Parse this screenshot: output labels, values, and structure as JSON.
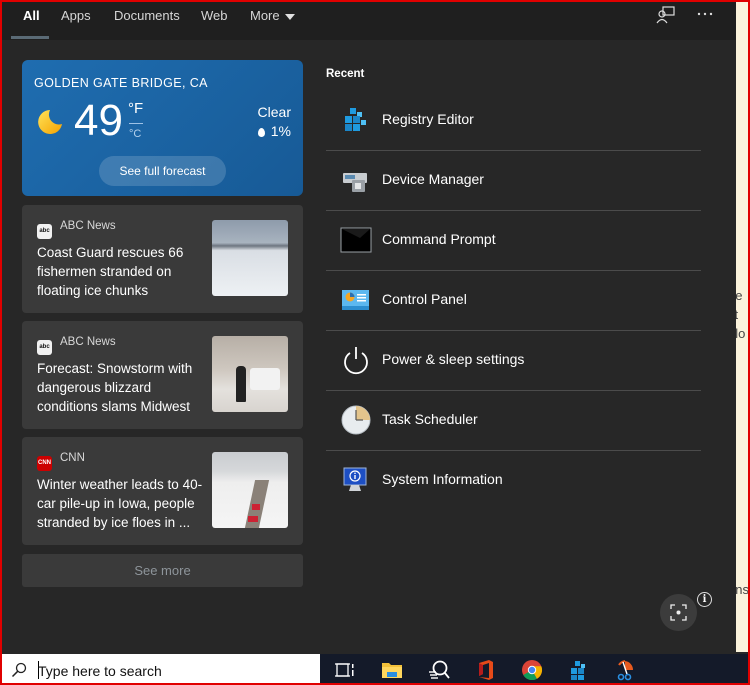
{
  "tabs": [
    {
      "label": "All",
      "active": true
    },
    {
      "label": "Apps"
    },
    {
      "label": "Documents"
    },
    {
      "label": "Web"
    },
    {
      "label": "More"
    }
  ],
  "header_icons": {
    "feedback": "feedback-icon",
    "more": "more-options-icon"
  },
  "weather": {
    "location": "GOLDEN GATE BRIDGE, CA",
    "temperature": "49",
    "unit_primary": "°F",
    "unit_secondary": "°C",
    "condition": "Clear",
    "precipitation": "1%",
    "forecast_button": "See full forecast",
    "icon": "moon-icon"
  },
  "news": [
    {
      "source": "ABC News",
      "source_badge": "abc",
      "headline": "Coast Guard rescues 66 fishermen stranded on floating ice chunks"
    },
    {
      "source": "ABC News",
      "source_badge": "abc",
      "headline": "Forecast: Snowstorm with dangerous blizzard conditions slams Midwest"
    },
    {
      "source": "CNN",
      "source_badge": "CNN",
      "headline": "Winter weather leads to 40-car pile-up in Iowa, people stranded by ice floes in ..."
    }
  ],
  "see_more": "See more",
  "recent": {
    "heading": "Recent",
    "items": [
      {
        "label": "Registry Editor",
        "icon": "registry-editor-icon"
      },
      {
        "label": "Device Manager",
        "icon": "device-manager-icon"
      },
      {
        "label": "Command Prompt",
        "icon": "command-prompt-icon"
      },
      {
        "label": "Control Panel",
        "icon": "control-panel-icon"
      },
      {
        "label": "Power & sleep settings",
        "icon": "power-icon"
      },
      {
        "label": "Task Scheduler",
        "icon": "task-scheduler-icon"
      },
      {
        "label": "System Information",
        "icon": "system-information-icon"
      }
    ]
  },
  "info_glyph": "i",
  "right_strip_text": [
    "ge",
    "ct",
    "alo",
    "ens"
  ],
  "taskbar": {
    "search_placeholder": "Type here to search",
    "apps": [
      "task-view-icon",
      "file-explorer-icon",
      "search-app-icon",
      "office-icon",
      "chrome-icon",
      "registry-editor-icon",
      "snipping-tool-icon"
    ]
  },
  "colors": {
    "accent_weather": "#1f6db0",
    "panel_bg": "#272727",
    "card_bg": "#3a3a3a",
    "taskbar_bg": "#141a29"
  }
}
